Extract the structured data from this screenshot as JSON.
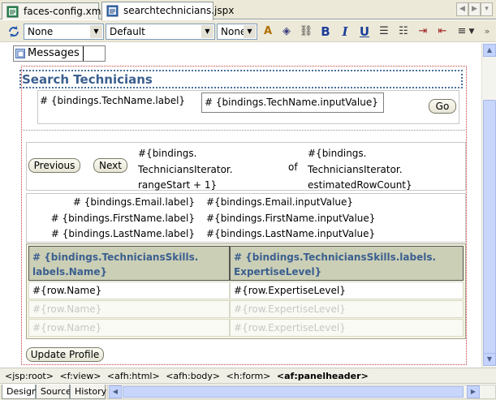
{
  "editor_tabs": [
    {
      "label": "faces-config.xml",
      "active": false
    },
    {
      "label": "searchtechnicians.jspx",
      "active": true
    }
  ],
  "toolbar": {
    "style_combo": "None",
    "font_combo": "Default",
    "size_combo": "None"
  },
  "messages_label": "Messages",
  "panel_header_text": "Search Technicians",
  "search": {
    "label": "# {bindings.TechName.label}",
    "input": "# {bindings.TechName.inputValue}",
    "go_button": "Go"
  },
  "navigation": {
    "previous_button": "Previous",
    "next_button": "Next",
    "range_start": [
      "#{bindings.",
      "TechniciansIterator.",
      "rangeStart + 1}"
    ],
    "of": "of",
    "row_count": [
      "#{bindings.",
      "TechniciansIterator.",
      "estimatedRowCount}"
    ]
  },
  "form_fields": [
    {
      "label": "# {bindings.Email.label}",
      "value": "#{bindings.Email.inputValue}"
    },
    {
      "label": "# {bindings.FirstName.label}",
      "value": "#{bindings.FirstName.inputValue}"
    },
    {
      "label": "# {bindings.LastName.label}",
      "value": "#{bindings.LastName.inputValue}"
    }
  ],
  "skills_table": {
    "headers": [
      [
        "# {bindings.TechniciansSkills.",
        "labels.Name}"
      ],
      [
        "# {bindings.TechniciansSkills.labels.",
        "ExpertiseLevel}"
      ]
    ],
    "rows": [
      [
        "#{row.Name}",
        "#{row.ExpertiseLevel}"
      ],
      [
        "#{row.Name}",
        "#{row.ExpertiseLevel}"
      ],
      [
        "#{row.Name}",
        "#{row.ExpertiseLevel}"
      ]
    ]
  },
  "update_button": "Update Profile",
  "tag_path": [
    "<jsp:root>",
    "<f:view>",
    "<afh:html>",
    "<afh:body>",
    "<h:form>"
  ],
  "tag_current": "<af:panelheader>",
  "view_tabs": [
    {
      "label": "Design",
      "active": true
    },
    {
      "label": "Source",
      "active": false
    },
    {
      "label": "History",
      "active": false
    }
  ],
  "colors": {
    "header_text": "#3b5f8f",
    "table_header_bg": "#cbcfb6",
    "ghost_text": "#c6c6c6"
  }
}
